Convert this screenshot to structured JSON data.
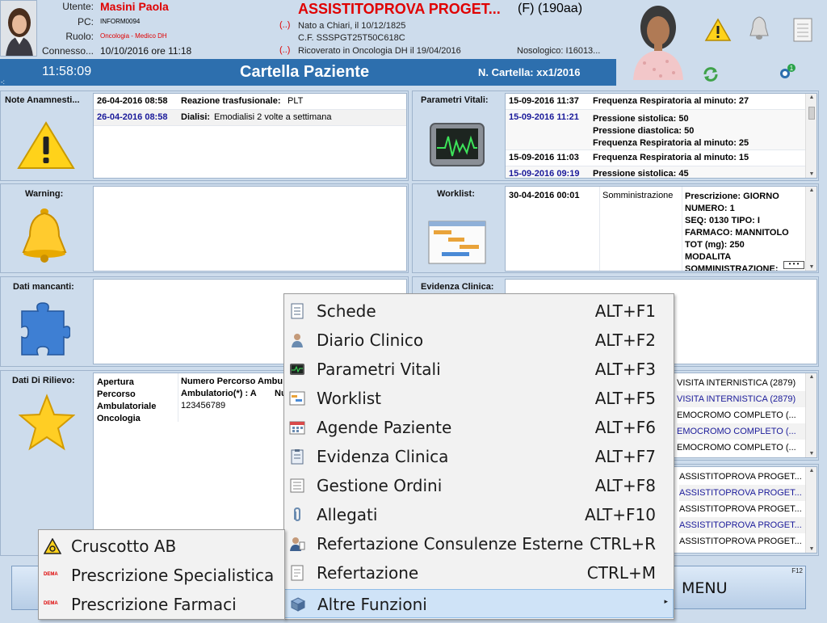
{
  "header": {
    "user_label": "Utente:",
    "user_value": "Masini Paola",
    "pc_label": "PC:",
    "pc_value": "INFORM0094",
    "role_label": "Ruolo:",
    "role_value": "Oncologia - Medico DH",
    "conn_label": "Connesso...",
    "conn_value": "10/10/2016 ore 11:18",
    "patient_name": "ASSISTITOPROVA  PROGET...",
    "patient_sex_age": "(F) (190aa)",
    "marker": "(..)",
    "birth": "Nato a Chiari, il 10/12/1825",
    "cf": "C.F. SSSPGT25T50C618C",
    "admission": "Ricoverato in Oncologia DH il 19/04/2016",
    "nosologico": "Nosologico: I16013..."
  },
  "bar": {
    "clock": "11:58:09",
    "title": "Cartella Paziente",
    "n_cartella": "N. Cartella: xx1/2016",
    "dots": "-:"
  },
  "panels": {
    "note": {
      "label": "Note Anamnesti...",
      "rows": [
        {
          "date": "26-04-2016 08:58",
          "kind": "Reazione trasfusionale:",
          "val": "PLT",
          "blue": false
        },
        {
          "date": "26-04-2016 08:58",
          "kind": "Dialisi:",
          "val": "Emodialisi 2 volte a settimana",
          "blue": true
        }
      ]
    },
    "warning": {
      "label": "Warning:"
    },
    "mancanti": {
      "label": "Dati mancanti:"
    },
    "rilievo": {
      "label": "Dati Di Rilievo:",
      "col1": "Apertura Percorso Ambulatoriale Oncologia",
      "col2_head": "Numero Percorso Ambu",
      "col2_line": "Ambulatorio(*) : A",
      "col2_extra": "Nu",
      "col2_val": "123456789"
    },
    "parametri": {
      "label": "Parametri Vitali:",
      "rows": [
        {
          "date": "15-09-2016 11:37",
          "lines": [
            "Frequenza Respiratoria al minuto:  27"
          ],
          "blue": false
        },
        {
          "date": "15-09-2016 11:21",
          "lines": [
            "Pressione sistolica:  50",
            "Pressione diastolica:  50",
            "Frequenza Respiratoria al minuto:  25"
          ],
          "blue": true
        },
        {
          "date": "15-09-2016 11:03",
          "lines": [
            "Frequenza Respiratoria al minuto:  15"
          ],
          "blue": false
        },
        {
          "date": "15-09-2016 09:19",
          "lines": [
            "Pressione sistolica:  45"
          ],
          "blue": true
        }
      ]
    },
    "worklist": {
      "label": "Worklist:",
      "date": "30-04-2016 00:01",
      "type": "Somministrazione",
      "lines": [
        "Prescrizione:  GIORNO",
        "NUMERO: 1",
        "SEQ: 0130 TIPO: I",
        "FARMACO: MANNITOLO",
        "TOT (mg): 250",
        "MODALITA",
        "SOMMINISTRAZIONE:"
      ]
    },
    "evidenza": {
      "label": "Evidenza Clinica:"
    },
    "right_list_a": [
      "VISITA INTERNISTICA (2879)",
      "VISITA INTERNISTICA (2879)",
      "EMOCROMO COMPLETO (...",
      "EMOCROMO COMPLETO (...",
      "EMOCROMO COMPLETO (..."
    ],
    "right_list_b": [
      "ASSISTITOPROVA  PROGET...",
      "ASSISTITOPROVA  PROGET...",
      "ASSISTITOPROVA  PROGET...",
      "ASSISTITOPROVA  PROGET...",
      "ASSISTITOPROVA  PROGET..."
    ]
  },
  "main_menu": {
    "items": [
      {
        "label": "Schede",
        "shortcut": "ALT+F1",
        "icon": "document-list-icon"
      },
      {
        "label": "Diario Clinico",
        "shortcut": "ALT+F2",
        "icon": "doctor-icon"
      },
      {
        "label": "Parametri Vitali",
        "shortcut": "ALT+F3",
        "icon": "monitor-icon"
      },
      {
        "label": "Worklist",
        "shortcut": "ALT+F5",
        "icon": "worklist-icon"
      },
      {
        "label": "Agende Paziente",
        "shortcut": "ALT+F6",
        "icon": "calendar-icon"
      },
      {
        "label": "Evidenza Clinica",
        "shortcut": "ALT+F7",
        "icon": "clipboard-icon"
      },
      {
        "label": "Gestione Ordini",
        "shortcut": "ALT+F8",
        "icon": "orders-icon"
      },
      {
        "label": "Allegati",
        "shortcut": "ALT+F10",
        "icon": "paperclip-icon"
      },
      {
        "label": "Refertazione Consulenze Esterne",
        "shortcut": "CTRL+R",
        "icon": "consult-icon"
      },
      {
        "label": "Refertazione",
        "shortcut": "CTRL+M",
        "icon": "report-icon"
      },
      {
        "label": "Altre Funzioni",
        "shortcut": "",
        "icon": "boxes-icon"
      }
    ]
  },
  "sub_menu": {
    "items": [
      {
        "label": "Cruscotto AB",
        "icon": "biohazard-icon"
      },
      {
        "label": "Prescrizione Specialistica",
        "icon": "dema-icon"
      },
      {
        "label": "Prescrizione Farmaci",
        "icon": "dema-icon"
      }
    ],
    "dema_text": "DEMA"
  },
  "menu_button": {
    "label": "MENU",
    "key": "F12"
  },
  "colors": {
    "accent_bar": "#2d6fae",
    "background": "#cddcec",
    "alert_red": "#e00000",
    "selected": "#cfe3f7"
  }
}
